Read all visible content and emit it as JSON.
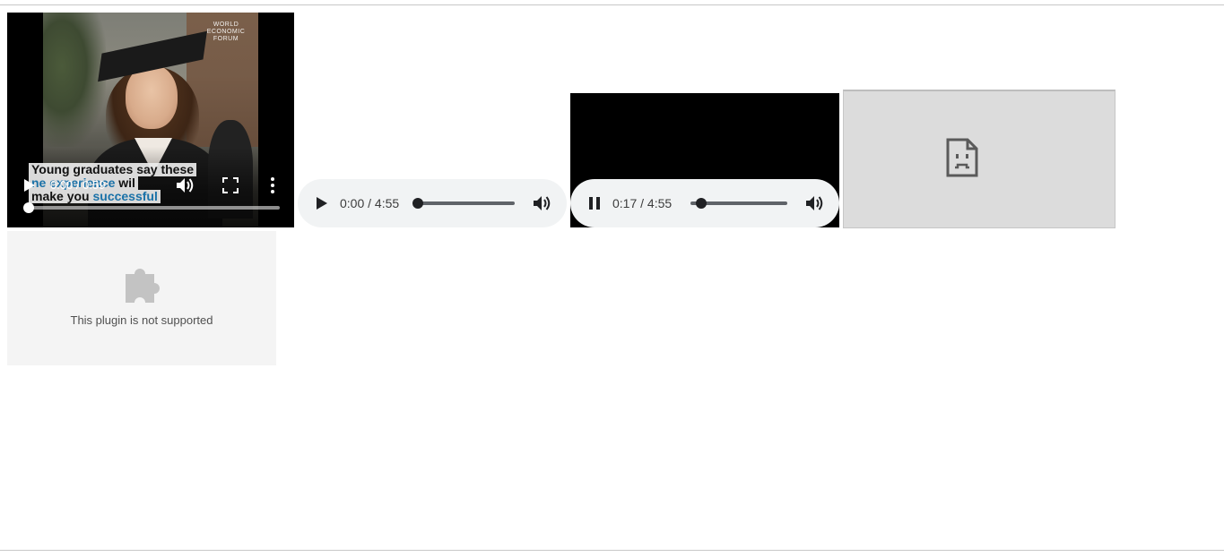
{
  "video": {
    "watermark_lines": [
      "WORLD",
      "ECONOMIC",
      "FORUM"
    ],
    "caption_line1": "Young graduates say these",
    "caption_line2_a": "ne experience",
    "caption_line2_b": " wil",
    "caption_line3_a": "make you ",
    "caption_line3_b": "successful",
    "time": "0:00 / 0:59",
    "progress": 0.0,
    "icons": {
      "play": "play-icon",
      "mute": "volume-icon",
      "fullscreen": "fullscreen-icon",
      "menu": "more-vert-icon"
    }
  },
  "audio_players": [
    {
      "state": "paused",
      "time": "0:00 / 4:55",
      "progress": 0.0
    },
    {
      "state": "playing",
      "time": "0:17 / 4:55",
      "progress": 0.058
    }
  ],
  "broken_image": {
    "icon": "sad-document-icon",
    "background": "#dcdcdc"
  },
  "plugin": {
    "icon": "puzzle-piece-icon",
    "message": "This plugin is not supported"
  },
  "colors": {
    "audio_bg": "#f1f3f4",
    "audio_track": "#5f6368",
    "caption_highlight": "#1b72a8"
  }
}
